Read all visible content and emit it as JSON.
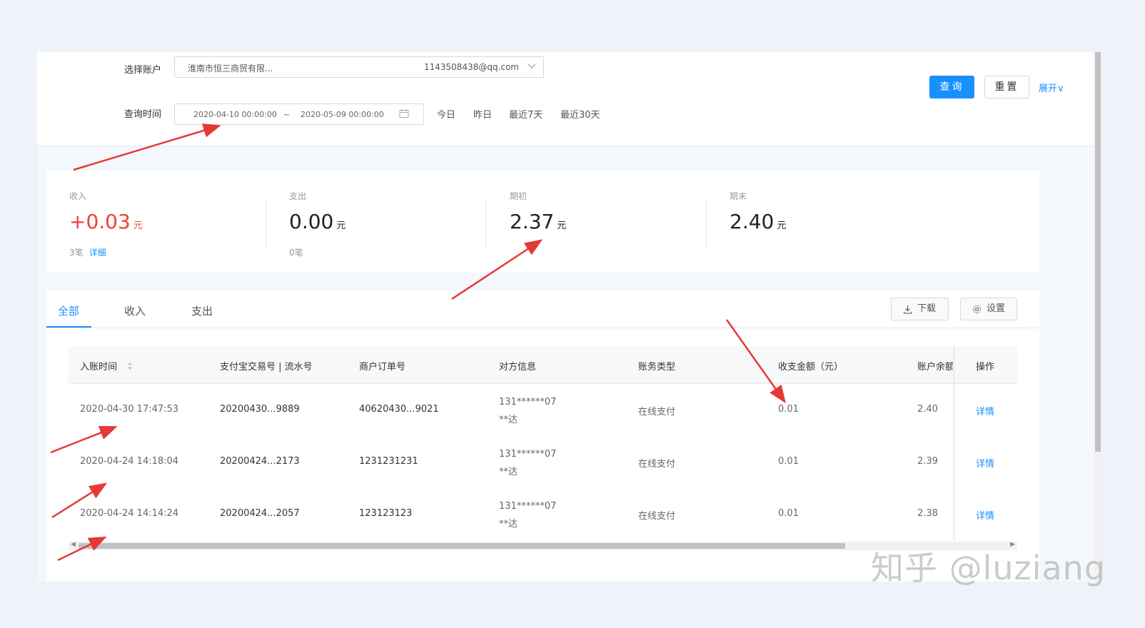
{
  "filter": {
    "account_label": "选择账户",
    "account_name": "淮南市恒三商贸有限...",
    "account_email": "1143508438@qq.com",
    "time_label": "查询时间",
    "start_time": "2020-04-10 00:00:00",
    "range_sep": "~",
    "end_time": "2020-05-09 00:00:00",
    "quick": [
      "今日",
      "昨日",
      "最近7天",
      "最近30天"
    ],
    "query_btn": "查询",
    "reset_btn": "重置",
    "expand": "展开∨"
  },
  "stats": [
    {
      "title": "收入",
      "value": "+0.03",
      "unit": "元",
      "count": "3笔",
      "link": "详细"
    },
    {
      "title": "支出",
      "value": "0.00",
      "unit": "元",
      "count": "0笔"
    },
    {
      "title": "期初",
      "value": "2.37",
      "unit": "元"
    },
    {
      "title": "期末",
      "value": "2.40",
      "unit": "元"
    }
  ],
  "tabs": [
    "全部",
    "收入",
    "支出"
  ],
  "toolbar": {
    "download": "下载",
    "settings": "设置"
  },
  "table": {
    "headers": [
      "入账时间",
      "支付宝交易号 | 流水号",
      "商户订单号",
      "对方信息",
      "账务类型",
      "收支金额（元）",
      "账户余额",
      "操作"
    ],
    "rows": [
      {
        "time": "2020-04-30 17:47:53",
        "trade_no": "20200430...9889",
        "order_no": "40620430...9021",
        "party_1": "131******07",
        "party_2": "**达",
        "type": "在线支付",
        "amount": "0.01",
        "balance": "2.40",
        "action": "详情"
      },
      {
        "time": "2020-04-24 14:18:04",
        "trade_no": "20200424...2173",
        "order_no": "1231231231",
        "party_1": "131******07",
        "party_2": "**达",
        "type": "在线支付",
        "amount": "0.01",
        "balance": "2.39",
        "action": "详情"
      },
      {
        "time": "2020-04-24 14:14:24",
        "trade_no": "20200424...2057",
        "order_no": "123123123",
        "party_1": "131******07",
        "party_2": "**达",
        "type": "在线支付",
        "amount": "0.01",
        "balance": "2.38",
        "action": "详情"
      }
    ]
  },
  "watermark": "知乎 @luziang",
  "colors": {
    "primary": "#1890ff",
    "income_red": "#f04134",
    "arrow_red": "#e53935"
  }
}
